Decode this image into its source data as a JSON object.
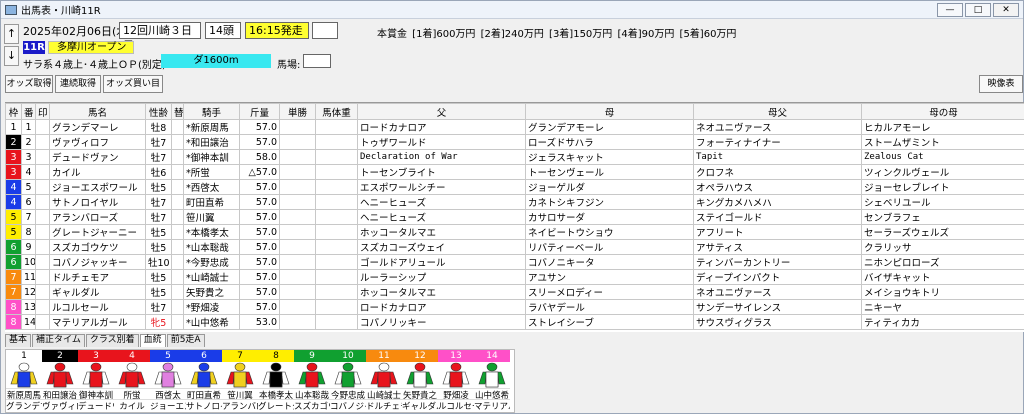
{
  "window": {
    "title": "出馬表・川崎11R",
    "btn_min": "—",
    "btn_max": "□",
    "btn_close": "✕"
  },
  "race": {
    "date": "2025年02月06日(木)",
    "meeting": "12回川崎３日目",
    "heads": "14頭",
    "start": "16:15発走",
    "race_no": "11R",
    "name": "多摩川オープン",
    "condition": "サラ系４歳上･４歳上ＯＰ(別定)",
    "distance": "ダ1600m",
    "baba_label": "馬場:",
    "prize": "本賞金 [1着]600万円 [2着]240万円 [3着]150万円 [4着]90万円 [5着]60万円",
    "up": "↑",
    "down": "↓"
  },
  "toolbar": {
    "odds_get": "オッズ取得",
    "renzoku": "連続取得",
    "odds_buy": "オッズ買い目",
    "video": "映像表"
  },
  "headers": [
    "枠",
    "番",
    "印",
    "馬名",
    "性齢",
    "替",
    "騎手",
    "斤量",
    "単勝",
    "馬体重",
    "父",
    "母",
    "母父",
    "母の母"
  ],
  "waku_colors": {
    "1": {
      "bg": "#ffffff",
      "fg": "#000000"
    },
    "2": {
      "bg": "#000000",
      "fg": "#ffffff"
    },
    "3": {
      "bg": "#e8141c",
      "fg": "#ffffff"
    },
    "4": {
      "bg": "#1a3ce8",
      "fg": "#ffffff"
    },
    "5": {
      "bg": "#ffee00",
      "fg": "#000000"
    },
    "6": {
      "bg": "#10a030",
      "fg": "#ffffff"
    },
    "7": {
      "bg": "#f88a0e",
      "fg": "#ffffff"
    },
    "8": {
      "bg": "#ff50c8",
      "fg": "#ffffff"
    }
  },
  "rows": [
    {
      "waku": "1",
      "num": "1",
      "mark": "",
      "name": "グランデマーレ",
      "sex": "牡8",
      "change": "",
      "jockey": "*新原周馬",
      "weight": "57.0",
      "odds": "",
      "bw": "",
      "sire": "ロードカナロア",
      "dam": "グランデアモーレ",
      "damsire": "ネオユニヴァース",
      "damdam": "ヒカルアモーレ",
      "sire_mono": false,
      "damdam_mono": false
    },
    {
      "waku": "2",
      "num": "2",
      "mark": "",
      "name": "ヴァヴィロフ",
      "sex": "牡7",
      "change": "",
      "jockey": "*和田譲治",
      "weight": "57.0",
      "odds": "",
      "bw": "",
      "sire": "トゥザワールド",
      "dam": "ローズドサハラ",
      "damsire": "フォーティナイナー",
      "damdam": "ストームザミント",
      "sire_mono": false,
      "damdam_mono": false
    },
    {
      "waku": "3",
      "num": "3",
      "mark": "",
      "name": "デュードヴァン",
      "sex": "牡7",
      "change": "",
      "jockey": "*御神本訓",
      "weight": "58.0",
      "odds": "",
      "bw": "",
      "sire": "Declaration of War",
      "dam": "ジェラスキャット",
      "damsire": "Tapit",
      "damdam": "Zealous Cat",
      "sire_mono": true,
      "damdam_mono": true
    },
    {
      "waku": "3",
      "num": "4",
      "mark": "",
      "name": "カイル",
      "sex": "牡6",
      "change": "",
      "jockey": "*所蛍",
      "weight": "△57.0",
      "odds": "",
      "bw": "",
      "sire": "トーセンブライト",
      "dam": "トーセンヴェール",
      "damsire": "クロフネ",
      "damdam": "ツィンクルヴェール",
      "sire_mono": false,
      "damdam_mono": false
    },
    {
      "waku": "4",
      "num": "5",
      "mark": "",
      "name": "ジョーエスポワール",
      "sex": "牡5",
      "change": "",
      "jockey": "*西啓太",
      "weight": "57.0",
      "odds": "",
      "bw": "",
      "sire": "エスポワールシチー",
      "dam": "ジョーゲルダ",
      "damsire": "オペラハウス",
      "damdam": "ジョーセレブレイト",
      "sire_mono": false,
      "damdam_mono": false
    },
    {
      "waku": "4",
      "num": "6",
      "mark": "",
      "name": "サトノロイヤル",
      "sex": "牡7",
      "change": "",
      "jockey": "町田直希",
      "weight": "57.0",
      "odds": "",
      "bw": "",
      "sire": "ヘニーヒューズ",
      "dam": "カネトシキフジン",
      "damsire": "キングカメハメハ",
      "damdam": "シェベリユール",
      "sire_mono": false,
      "damdam_mono": false
    },
    {
      "waku": "5",
      "num": "7",
      "mark": "",
      "name": "アランバローズ",
      "sex": "牡7",
      "change": "",
      "jockey": "笹川翼",
      "weight": "57.0",
      "odds": "",
      "bw": "",
      "sire": "ヘニーヒューズ",
      "dam": "カサロサーダ",
      "damsire": "ステイゴールド",
      "damdam": "センブラフェ",
      "sire_mono": false,
      "damdam_mono": false
    },
    {
      "waku": "5",
      "num": "8",
      "mark": "",
      "name": "グレートジャーニー",
      "sex": "牡5",
      "change": "",
      "jockey": "*本橋孝太",
      "weight": "57.0",
      "odds": "",
      "bw": "",
      "sire": "ホッコータルマエ",
      "dam": "ネイビートウショウ",
      "damsire": "アフリート",
      "damdam": "セーラーズウェルズ",
      "sire_mono": false,
      "damdam_mono": false
    },
    {
      "waku": "6",
      "num": "9",
      "mark": "",
      "name": "スズカゴウケツ",
      "sex": "牡5",
      "change": "",
      "jockey": "*山本聡哉",
      "weight": "57.0",
      "odds": "",
      "bw": "",
      "sire": "スズカコーズウェイ",
      "dam": "リバティーベール",
      "damsire": "アサティス",
      "damdam": "クラリッサ",
      "sire_mono": false,
      "damdam_mono": false
    },
    {
      "waku": "6",
      "num": "10",
      "mark": "",
      "name": "コバノジャッキー",
      "sex": "牡10",
      "change": "",
      "jockey": "*今野忠成",
      "weight": "57.0",
      "odds": "",
      "bw": "",
      "sire": "ゴールドアリュール",
      "dam": "コバノニキータ",
      "damsire": "ティンバーカントリー",
      "damdam": "ニホンピロローズ",
      "sire_mono": false,
      "damdam_mono": false
    },
    {
      "waku": "7",
      "num": "11",
      "mark": "",
      "name": "ドルチェモア",
      "sex": "牡5",
      "change": "",
      "jockey": "*山崎誠士",
      "weight": "57.0",
      "odds": "",
      "bw": "",
      "sire": "ルーラーシップ",
      "dam": "アユサン",
      "damsire": "ディープインパクト",
      "damdam": "バイザキャット",
      "sire_mono": false,
      "damdam_mono": false
    },
    {
      "waku": "7",
      "num": "12",
      "mark": "",
      "name": "ギャルダル",
      "sex": "牡5",
      "change": "",
      "jockey": "矢野貴之",
      "weight": "57.0",
      "odds": "",
      "bw": "",
      "sire": "ホッコータルマエ",
      "dam": "スリーメロディー",
      "damsire": "ネオユニヴァース",
      "damdam": "メイショウキトリ",
      "sire_mono": false,
      "damdam_mono": false
    },
    {
      "waku": "8",
      "num": "13",
      "mark": "",
      "name": "ルコルセール",
      "sex": "牡7",
      "change": "",
      "jockey": "*野畑凌",
      "weight": "57.0",
      "odds": "",
      "bw": "",
      "sire": "ロードカナロア",
      "dam": "ラバヤデール",
      "damsire": "サンデーサイレンス",
      "damdam": "ニキーヤ",
      "sire_mono": false,
      "damdam_mono": false
    },
    {
      "waku": "8",
      "num": "14",
      "mark": "",
      "name": "マテリアルガール",
      "sex": "牝5",
      "change": "",
      "jockey": "*山中悠希",
      "weight": "53.0",
      "odds": "",
      "bw": "",
      "sire": "コパノリッキー",
      "dam": "ストレイシーブ",
      "damsire": "サウスヴィグラス",
      "damdam": "ティティカカ",
      "sire_mono": false,
      "damdam_mono": false,
      "female": true
    }
  ],
  "tabs": [
    "基本",
    "補正タイム",
    "クラス別着",
    "血統",
    "前5走A"
  ],
  "silks": [
    {
      "num": "1",
      "head_bg": "#ffffff",
      "head_fg": "#000000",
      "body": "#1a3ce8",
      "sleeve": "#f0d020",
      "cap": "#ffffff",
      "jockey": "新原周馬",
      "horse": "グランデマ"
    },
    {
      "num": "2",
      "head_bg": "#000000",
      "head_fg": "#ffffff",
      "body": "#e8141c",
      "sleeve": "#e8141c",
      "cap": "#e8141c",
      "jockey": "和田譲治",
      "horse": "ヴァヴィロ"
    },
    {
      "num": "3",
      "head_bg": "#e8141c",
      "head_fg": "#ffffff",
      "body": "#e8141c",
      "sleeve": "#ffffff",
      "cap": "#e8141c",
      "jockey": "御神本訓",
      "horse": "デュードヴ"
    },
    {
      "num": "4",
      "head_bg": "#e8141c",
      "head_fg": "#ffffff",
      "body": "#e8141c",
      "sleeve": "#e8141c",
      "cap": "#ffffff",
      "jockey": "所蛍",
      "horse": "カイル"
    },
    {
      "num": "5",
      "head_bg": "#1a3ce8",
      "head_fg": "#ffffff",
      "body": "#e080e0",
      "sleeve": "#ffffff",
      "cap": "#e080e0",
      "jockey": "西啓太",
      "horse": "ジョーエス"
    },
    {
      "num": "6",
      "head_bg": "#1a3ce8",
      "head_fg": "#ffffff",
      "body": "#1a3ce8",
      "sleeve": "#f0d020",
      "cap": "#1a3ce8",
      "jockey": "町田直希",
      "horse": "サトノロイ"
    },
    {
      "num": "7",
      "head_bg": "#ffee00",
      "head_fg": "#000000",
      "body": "#f0d020",
      "sleeve": "#e8141c",
      "cap": "#f0d020",
      "jockey": "笹川翼",
      "horse": "アランバロ"
    },
    {
      "num": "8",
      "head_bg": "#ffee00",
      "head_fg": "#000000",
      "body": "#000000",
      "sleeve": "#ffffff",
      "cap": "#000000",
      "jockey": "本橋孝太",
      "horse": "グレートジ"
    },
    {
      "num": "9",
      "head_bg": "#10a030",
      "head_fg": "#ffffff",
      "body": "#e8141c",
      "sleeve": "#10a030",
      "cap": "#e8141c",
      "jockey": "山本聡哉",
      "horse": "スズカゴウ"
    },
    {
      "num": "10",
      "head_bg": "#10a030",
      "head_fg": "#ffffff",
      "body": "#10a030",
      "sleeve": "#ffffff",
      "cap": "#10a030",
      "jockey": "今野忠成",
      "horse": "コバノジャ"
    },
    {
      "num": "11",
      "head_bg": "#f88a0e",
      "head_fg": "#ffffff",
      "body": "#e8141c",
      "sleeve": "#e8141c",
      "cap": "#ffffff",
      "jockey": "山崎誠士",
      "horse": "ドルチェモ"
    },
    {
      "num": "12",
      "head_bg": "#f88a0e",
      "head_fg": "#ffffff",
      "body": "#ffffff",
      "sleeve": "#10a030",
      "cap": "#e8141c",
      "jockey": "矢野貴之",
      "horse": "ギャルダル"
    },
    {
      "num": "13",
      "head_bg": "#ff50c8",
      "head_fg": "#ffffff",
      "body": "#e8141c",
      "sleeve": "#ffffff",
      "cap": "#e8141c",
      "jockey": "野畑凌",
      "horse": "ルコルセー"
    },
    {
      "num": "14",
      "head_bg": "#ff50c8",
      "head_fg": "#ffffff",
      "body": "#ffffff",
      "sleeve": "#10a030",
      "cap": "#10a030",
      "jockey": "山中悠希",
      "horse": "マテリアル"
    }
  ]
}
